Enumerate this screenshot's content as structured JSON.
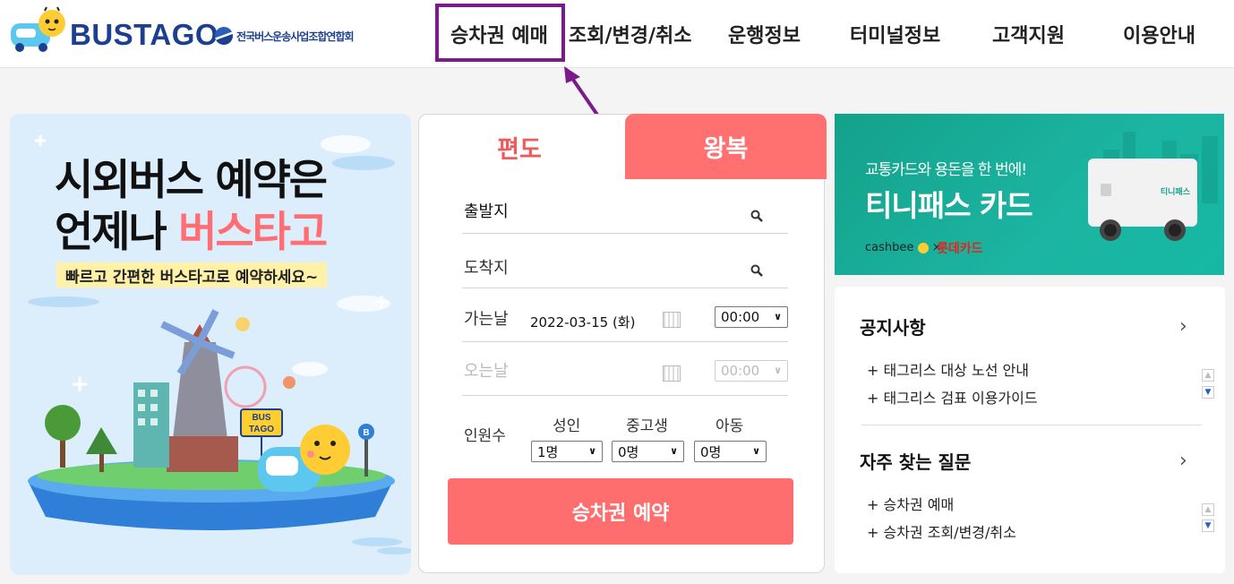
{
  "header": {
    "brand": "BUSTAGO",
    "association": "전국버스운송사업조합연합회",
    "nav": [
      {
        "label": "승차권 예매"
      },
      {
        "label": "조회/변경/취소"
      },
      {
        "label": "운행정보"
      },
      {
        "label": "터미널정보"
      },
      {
        "label": "고객지원"
      },
      {
        "label": "이용안내"
      }
    ]
  },
  "promo_left": {
    "line1": "시외버스 예약은",
    "line2_prefix": "언제나 ",
    "line2_accent": "버스타고",
    "subtitle": "빠르고 간편한 버스타고로 예약하세요~",
    "sign_line1": "BUS",
    "sign_line2": "TAGO",
    "stop_letter": "B"
  },
  "booking": {
    "tabs": {
      "oneway": "편도",
      "round": "왕복"
    },
    "departure_label": "출발지",
    "arrival_label": "도착지",
    "go_date_label": "가는날",
    "go_date_value": "2022-03-15 (화)",
    "go_time_value": "00:00",
    "return_date_label": "오는날",
    "return_time_value": "00:00",
    "passengers_label": "인원수",
    "adult_label": "성인",
    "teen_label": "중고생",
    "child_label": "아동",
    "adult_value": "1명",
    "teen_value": "0명",
    "child_value": "0명",
    "reserve_button": "승차권 예약"
  },
  "promo_right": {
    "line1": "교통카드와 용돈을 한 번에!",
    "line2": "티니패스 카드",
    "cashbee": "cashbee",
    "times": "×",
    "lotte": "롯데카드",
    "card_label": "티니패스"
  },
  "notices": {
    "notice_title": "공지사항",
    "notice_items": [
      "+ 태그리스 대상 노선 안내",
      "+ 태그리스 검표 이용가이드"
    ],
    "faq_title": "자주 찾는 질문",
    "faq_items": [
      "+ 승차권 예매",
      "+ 승차권 조회/변경/취소"
    ]
  },
  "colors": {
    "brand_blue": "#1d3f8f",
    "accent_coral": "#ff6e6e",
    "annotation_purple": "#7b1a8c",
    "promo_teal": "#1bb5a2"
  }
}
